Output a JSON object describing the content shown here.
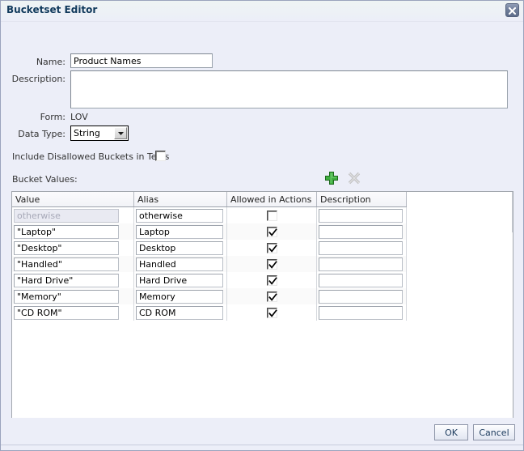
{
  "window": {
    "title": "Bucketset Editor",
    "close_icon": "close-x-icon"
  },
  "form": {
    "name_label": "Name:",
    "name_value": "Product Names",
    "name_placeholder": "",
    "description_label": "Description:",
    "description_value": "",
    "description_placeholder": "",
    "form_label": "Form:",
    "form_value": "LOV",
    "datatype_label": "Data Type:",
    "datatype_value": "String",
    "datatype_options": [
      "String"
    ],
    "include_disallowed_label": "Include Disallowed Buckets in Tests",
    "include_disallowed_checked": false,
    "bucket_values_label": "Bucket Values:"
  },
  "toolbar": {
    "add_icon": "plus-icon",
    "add_title": "Add",
    "delete_icon": "delete-x-icon",
    "delete_title": "Delete",
    "delete_disabled": true
  },
  "table": {
    "columns": [
      "Value",
      "Alias",
      "Allowed in Actions",
      "Description"
    ],
    "rows": [
      {
        "value": "otherwise",
        "value_disabled": true,
        "alias": "otherwise",
        "allowed": false,
        "description": ""
      },
      {
        "value": "\"Laptop\"",
        "value_disabled": false,
        "alias": "Laptop",
        "allowed": true,
        "description": ""
      },
      {
        "value": "\"Desktop\"",
        "value_disabled": false,
        "alias": "Desktop",
        "allowed": true,
        "description": ""
      },
      {
        "value": "\"Handled\"",
        "value_disabled": false,
        "alias": "Handled",
        "allowed": true,
        "description": ""
      },
      {
        "value": "\"Hard Drive\"",
        "value_disabled": false,
        "alias": "Hard Drive",
        "allowed": true,
        "description": ""
      },
      {
        "value": "\"Memory\"",
        "value_disabled": false,
        "alias": "Memory",
        "allowed": true,
        "description": ""
      },
      {
        "value": "\"CD ROM\"",
        "value_disabled": false,
        "alias": "CD ROM",
        "allowed": true,
        "description": ""
      }
    ]
  },
  "footer": {
    "ok_label": "OK",
    "cancel_label": "Cancel"
  },
  "colors": {
    "dialog_background": "#eceef8",
    "title_text": "#113a5c",
    "add_icon_green": "#2f9e2f",
    "delete_icon_gray": "#b3b3b3",
    "button_text": "#1b3a5c"
  }
}
